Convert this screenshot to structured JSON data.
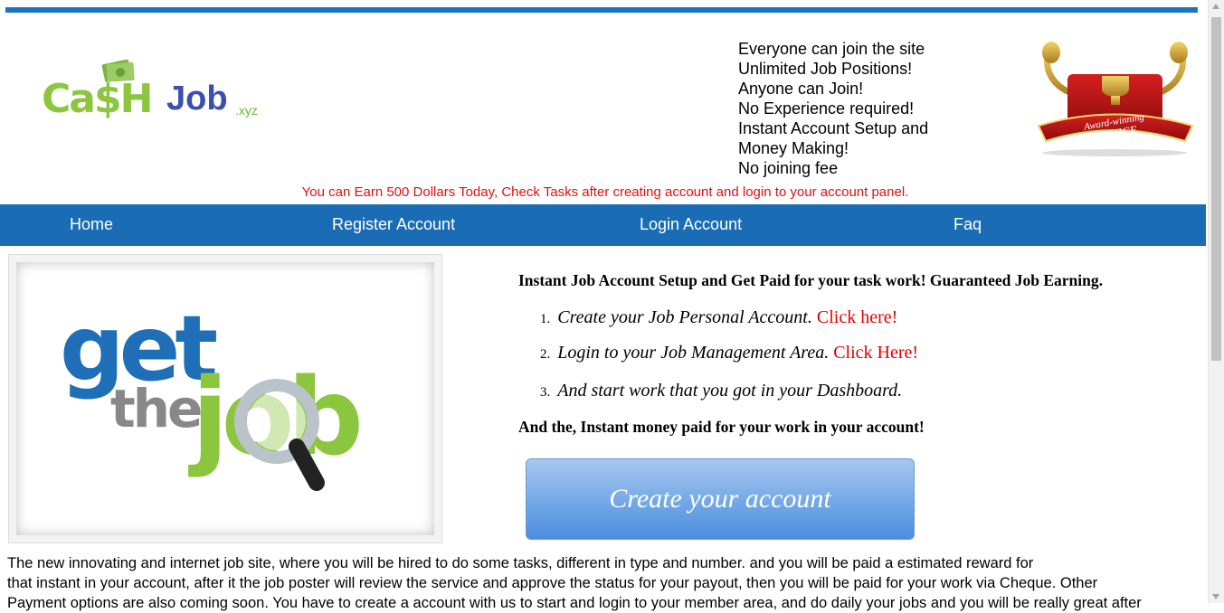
{
  "logo": {
    "cash": "Ca$H",
    "job": "Job",
    "tld": ".xyz"
  },
  "features": [
    "Everyone can join the site",
    "Unlimited Job Positions!",
    "Anyone can Join!",
    "No Experience required!",
    "Instant Account Setup and",
    "Money Making!",
    "No joining fee"
  ],
  "award": {
    "line1": "Award-winning",
    "line2": "SERVICE"
  },
  "promo": "You can Earn 500 Dollars Today, Check Tasks after creating account and login to your account panel.",
  "nav": {
    "home": "Home",
    "register": "Register Account",
    "login": "Login Account",
    "faq": "Faq"
  },
  "hero_image": {
    "word1": "get",
    "word2": "the",
    "word3": "job"
  },
  "intro": {
    "title": "Instant Job Account Setup and Get Paid for your task work! Guaranteed Job Earning.",
    "steps": [
      {
        "num": "1.",
        "text": "Create your Job Personal Account.",
        "link": "Click here!"
      },
      {
        "num": "2.",
        "text": "Login to your Job Management Area.",
        "link": "Click Here!"
      },
      {
        "num": "3.",
        "text": "And start work that you got in your Dashboard.",
        "link": ""
      }
    ],
    "money_line": "And the, Instant money paid for your work in your account!"
  },
  "create_button": "Create your account",
  "description": [
    "The new innovating and internet job site, where you will be hired to do some tasks, different in type and number. and you will be paid a estimated reward for",
    "that instant in your account, after it the job poster will review the service and approve the status for your payout, then you will be paid for your work via Cheque. Other",
    "Payment options are also coming soon. You have to create a account with us to start and login to your member area, and do daily your jobs and you will be really great after"
  ],
  "colors": {
    "nav": "#1a6db4",
    "accent_green": "#8cc63f",
    "link_red": "#e00000",
    "job_blue": "#3a4fb0"
  }
}
